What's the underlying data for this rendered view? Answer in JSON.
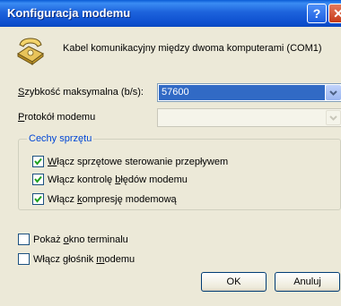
{
  "window": {
    "title": "Konfiguracja modemu"
  },
  "titlebar": {
    "help_glyph": "?",
    "close_glyph": "✕"
  },
  "device": {
    "icon": "modem-phone-icon",
    "label": "Kabel komunikacyjny między dwoma komputerami (COM1)"
  },
  "speed": {
    "label_first": "S",
    "label_rest": "zybkość maksymalna (b/s):",
    "value": "57600"
  },
  "protocol": {
    "label_first": "P",
    "label_rest": "rotokół modemu",
    "value": ""
  },
  "hardware_group": {
    "title": "Cechy sprzętu",
    "options": [
      {
        "pre": "",
        "ul": "W",
        "post": "łącz sprzętowe sterowanie przepływem",
        "checked": true
      },
      {
        "pre": "Włącz kontrolę ",
        "ul": "b",
        "post": "łędów modemu",
        "checked": true
      },
      {
        "pre": "Włącz ",
        "ul": "k",
        "post": "ompresję modemową",
        "checked": true
      }
    ]
  },
  "terminal": {
    "pre": "Pokaż ",
    "ul": "o",
    "post": "kno terminalu",
    "checked": false
  },
  "speaker": {
    "pre": "Włącz głośnik ",
    "ul": "m",
    "post": "odemu",
    "checked": false
  },
  "buttons": {
    "ok": "OK",
    "cancel": "Anuluj"
  },
  "colors": {
    "titlebar": "#0a5bd6",
    "selection": "#316ac5",
    "group_title": "#0046d5",
    "face": "#ece9d8"
  }
}
